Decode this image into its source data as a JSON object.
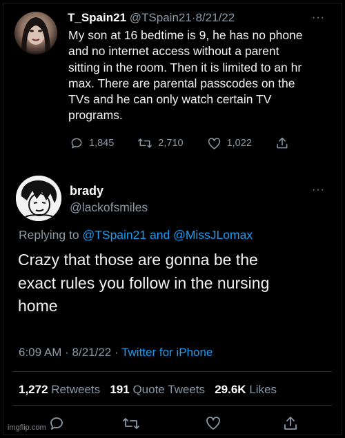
{
  "tweet1": {
    "name": "T_Spain21",
    "handle": "@TSpain21",
    "separator": "·",
    "date": "8/21/22",
    "more": "···",
    "lines": [
      "My son at 16 bedtime is 9, he has no phone",
      "and no internet access without a parent",
      "sitting in the room. Then it is limited to an hr",
      "max.  There are parental passcodes on the",
      "TVs and he can only watch certain TV",
      "programs."
    ],
    "replies": "1,845",
    "retweets": "2,710",
    "likes": "1,022",
    "icons": [
      "reply-icon",
      "retweet-icon",
      "like-icon",
      "share-icon"
    ]
  },
  "tweet2": {
    "name": "brady",
    "handle": "@lackofsmiles",
    "more": "···",
    "replying_prefix": "Replying to",
    "replying_user1": "@TSpain21",
    "replying_and": "and",
    "replying_user2": "@MissJLomax",
    "lines": [
      "Crazy that those are gonna be the",
      "exact rules you follow in the nursing",
      "home"
    ],
    "time": "6:09 AM",
    "date": "8/21/22",
    "separator": "·",
    "source": "Twitter for iPhone",
    "retweets_count": "1,272",
    "retweets_label": "Retweets",
    "quotes_count": "191",
    "quotes_label": "Quote Tweets",
    "likes_count": "29.6K",
    "likes_label": "Likes"
  },
  "watermark": "imgflip.com",
  "colors": {
    "background": "#000000",
    "text": "#e7e9ea",
    "secondary": "#8b98a5",
    "link": "#1d9bf0"
  }
}
